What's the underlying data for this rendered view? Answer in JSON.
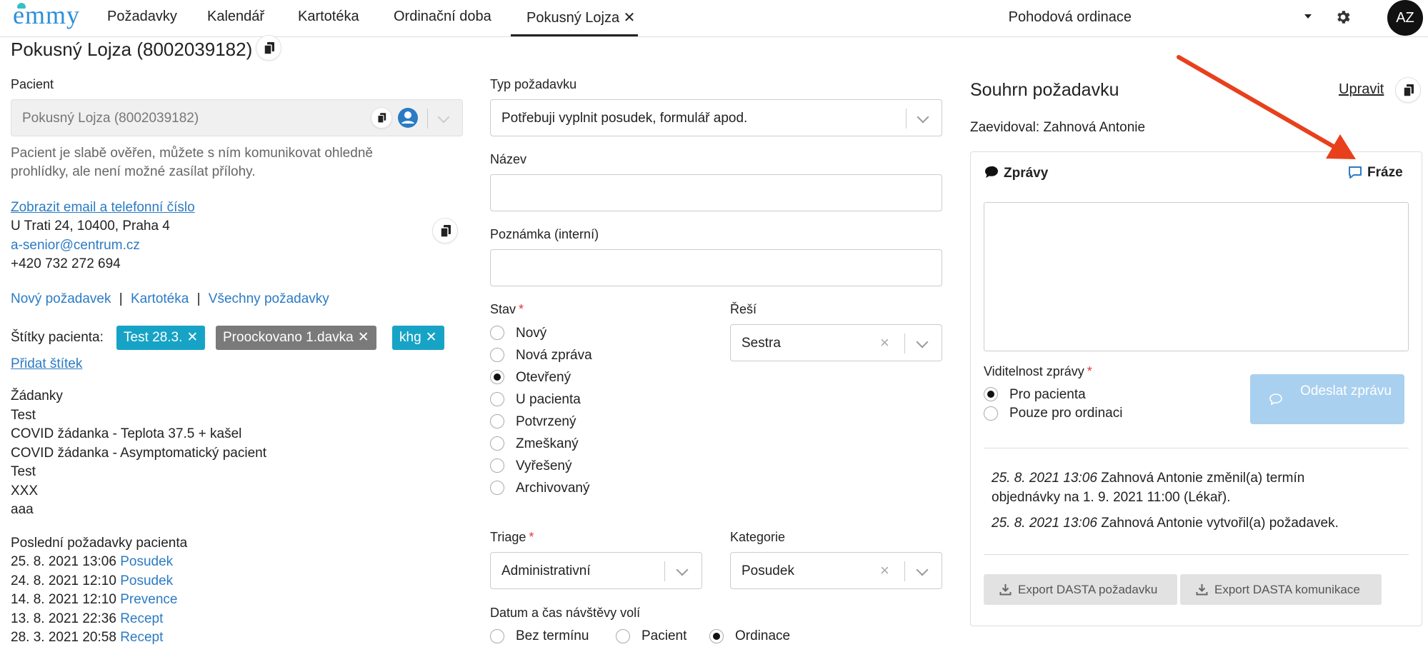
{
  "nav": {
    "logo": "emmy",
    "tabs": [
      "Požadavky",
      "Kalendář",
      "Kartotéka",
      "Ordinační doba"
    ],
    "active_tab": "Pokusný Lojza",
    "active_tab_close": "✕",
    "practice": "Pohodová ordinace",
    "avatar": "AZ"
  },
  "page_title": "Pokusný Lojza (8002039182)",
  "patient": {
    "label": "Pacient",
    "value": "Pokusný Lojza (8002039182)",
    "note_line1": "Pacient je slabě ověřen, můžete s ním komunikovat ohledně",
    "note_line2": "prohlídky, ale není možné zasílat přílohy.",
    "show_contact": "Zobrazit email a telefonní číslo",
    "address": "U Trati 24, 10400, Praha 4",
    "email": "a-senior@centrum.cz",
    "phone": "+420 732 272 694",
    "links": [
      "Nový požadavek",
      "Kartotéka",
      "Všechny požadavky"
    ],
    "link_sep": "|",
    "tags_label": "Štítky pacienta:",
    "tags": [
      {
        "label": "Test 28.3.",
        "color": "#17a3c6"
      },
      {
        "label": "Proockovano 1.davka",
        "color": "#7a7a7a"
      },
      {
        "label": "khg",
        "color": "#17a3c6"
      }
    ],
    "tag_remove": "✕",
    "add_tag": "Přidat štítek",
    "requests_heading": "Žádanky",
    "requests": [
      "Test",
      "COVID žádanka - Teplota 37.5 + kašel",
      "COVID žádanka - Asymptomatický pacient",
      "Test",
      "XXX",
      "aaa"
    ],
    "recent_heading": "Poslední požadavky pacienta",
    "recent": [
      {
        "date": "25. 8. 2021 13:06",
        "type": "Posudek"
      },
      {
        "date": "24. 8. 2021 12:10",
        "type": "Posudek"
      },
      {
        "date": "14. 8. 2021 12:10",
        "type": "Prevence"
      },
      {
        "date": "13. 8. 2021 22:36",
        "type": "Recept"
      },
      {
        "date": "28. 3. 2021 20:58",
        "type": "Recept"
      }
    ]
  },
  "form": {
    "type_label": "Typ požadavku",
    "type_value": "Potřebuji vyplnit posudek, formulář apod.",
    "name_label": "Název",
    "note_label": "Poznámka (interní)",
    "state_label": "Stav",
    "required_mark": "*",
    "states": [
      "Nový",
      "Nová zpráva",
      "Otevřený",
      "U pacienta",
      "Potvrzený",
      "Zmeškaný",
      "Vyřešený",
      "Archivovaný"
    ],
    "state_selected": 2,
    "solver_label": "Řeší",
    "solver_value": "Sestra",
    "triage_label": "Triage",
    "triage_value": "Administrativní",
    "category_label": "Kategorie",
    "category_value": "Posudek",
    "visit_label": "Datum a čas návštěvy volí",
    "visit_options": [
      "Bez termínu",
      "Pacient",
      "Ordinace"
    ],
    "visit_selected": 2
  },
  "summary": {
    "title": "Souhrn požadavku",
    "edit": "Upravit",
    "recorded_by": "Zaevidoval: Zahnová Antonie",
    "messages_title": "Zprávy",
    "phrases": "Fráze",
    "visibility_label": "Viditelnost zprávy",
    "visibility_options": [
      "Pro pacienta",
      "Pouze pro ordinaci"
    ],
    "visibility_selected": 0,
    "send_button": "Odeslat zprávu",
    "log": [
      {
        "time": "25. 8. 2021 13:06",
        "who": "Zahnová Antonie",
        "text1": " změnil(a) termín",
        "text2": "objednávky na 1. 9. 2021 11:00 (Lékař)."
      },
      {
        "time": "25. 8. 2021 13:06",
        "who": "Zahnová Antonie",
        "text1": " vytvořil(a) požadavek.",
        "text2": ""
      }
    ],
    "export_request": "Export DASTA požadavku",
    "export_communication": "Export DASTA komunikace"
  },
  "colors": {
    "link": "#2b7bc4",
    "tag_blue": "#17a3c6",
    "tag_gray": "#7a7a7a",
    "send_disabled": "#a9d0ef",
    "arrow": "#e8401c",
    "required": "#e53935"
  }
}
